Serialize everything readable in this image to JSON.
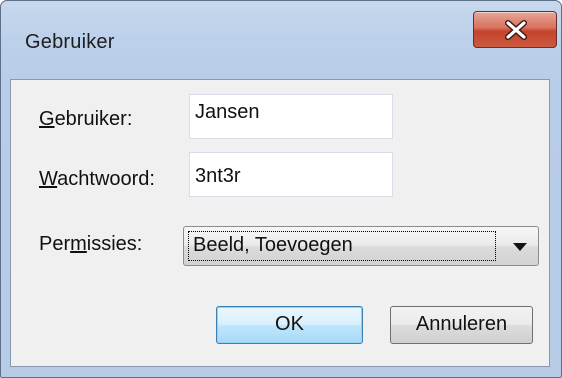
{
  "window": {
    "title": "Gebruiker",
    "close_icon": "close-x-icon"
  },
  "form": {
    "user": {
      "label_accel": "G",
      "label_rest": "ebruiker:",
      "value": "Jansen"
    },
    "password": {
      "label_accel": "W",
      "label_rest": "achtwoord:",
      "value": "3nt3r"
    },
    "permissions": {
      "label_pre": "Per",
      "label_accel": "m",
      "label_rest": "issies:",
      "selected": "Beeld, Toevoegen",
      "arrow_icon": "dropdown-arrow-icon"
    }
  },
  "buttons": {
    "ok_label": "OK",
    "cancel_label": "Annuleren"
  },
  "colors": {
    "titlebar": "#bcd0ea",
    "client": "#f0f0f0",
    "close_button": "#c4432b",
    "ok_button_border": "#3c7fb1"
  }
}
